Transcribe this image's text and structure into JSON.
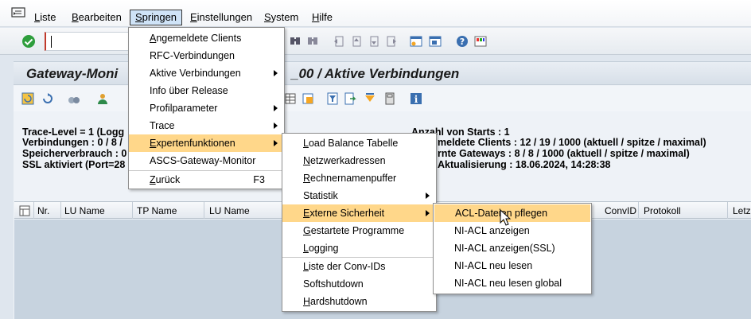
{
  "menubar": {
    "items": [
      {
        "label": "Liste",
        "u": "L",
        "rest": "iste"
      },
      {
        "label": "Bearbeiten",
        "u": "B",
        "rest": "earbeiten"
      },
      {
        "label": "Springen",
        "u": "S",
        "rest": "pringen"
      },
      {
        "label": "Einstellungen",
        "u": "E",
        "rest": "instellungen"
      },
      {
        "label": "System",
        "u": "S",
        "rest": "ystem"
      },
      {
        "label": "Hilfe",
        "u": "H",
        "rest": "ilfe"
      }
    ]
  },
  "title": {
    "left": "Gateway-Moni",
    "right": "_00 / Aktive Verbindungen"
  },
  "info": {
    "line1_left": "Trace-Level = 1 (Logg",
    "line2_left": "Verbindungen : 0 / 8 /",
    "line3_left": "Speicherverbrauch : 0",
    "line4_left": "SSL aktiviert (Port=28",
    "line1_right": "Anzahl von Starts : 1",
    "line2_right": "meldete Clients : 12 / 19 / 1000 (aktuell / spitze / maximal)",
    "line3_right": "rnte Gateways : 8 / 8 / 1000 (aktuell / spitze / maximal)",
    "line4_right": "Aktualisierung : 18.06.2024, 14:28:38"
  },
  "grid": {
    "columns": [
      "Nr.",
      "LU Name",
      "TP Name",
      "LU Name",
      "ConvID",
      "Protokoll",
      "Letz"
    ]
  },
  "springen_menu": {
    "items": [
      {
        "label": "Angemeldete Clients",
        "u": "A",
        "rest": "ngemeldete Clients",
        "submenu": false
      },
      {
        "label": "RFC-Verbindungen",
        "u": "",
        "rest": "RFC-Verbindungen",
        "submenu": false
      },
      {
        "label": "Aktive Verbindungen",
        "u": "",
        "rest": "Aktive Verbindungen",
        "submenu": true
      },
      {
        "label": "Info über Release",
        "u": "",
        "rest": "Info über Release",
        "submenu": false
      },
      {
        "label": "Profilparameter",
        "u": "",
        "rest": "Profilparameter",
        "submenu": true
      },
      {
        "label": "Trace",
        "u": "",
        "rest": "Trace",
        "submenu": true
      },
      {
        "label": "Expertenfunktionen",
        "u": "E",
        "rest": "xpertenfunktionen",
        "submenu": true
      },
      {
        "label": "ASCS-Gateway-Monitor",
        "u": "",
        "rest": "ASCS-Gateway-Monitor",
        "submenu": false
      },
      {
        "label": "Zurück",
        "u": "Z",
        "rest": "urück",
        "submenu": false,
        "shortcut": "F3"
      }
    ]
  },
  "experten_menu": {
    "items": [
      {
        "label": "Load Balance Tabelle",
        "u": "L",
        "rest": "oad Balance Tabelle",
        "submenu": false
      },
      {
        "label": "Netzwerkadressen",
        "u": "N",
        "rest": "etzwerkadressen",
        "submenu": false
      },
      {
        "label": "Rechnernamenpuffer",
        "u": "R",
        "rest": "echnernamenpuffer",
        "submenu": false
      },
      {
        "label": "Statistik",
        "u": "",
        "rest": "Statistik",
        "submenu": true
      },
      {
        "label": "Externe Sicherheit",
        "u": "E",
        "rest": "xterne Sicherheit",
        "submenu": true
      },
      {
        "label": "Gestartete Programme",
        "u": "G",
        "rest": "estartete Programme",
        "submenu": false
      },
      {
        "label": "Logging",
        "u": "L",
        "rest": "ogging",
        "submenu": false
      },
      {
        "label": "Liste der Conv-IDs",
        "u": "L",
        "rest": "iste der Conv-IDs",
        "submenu": false
      },
      {
        "label": "Softshutdown",
        "u": "",
        "rest": "Softshutdown",
        "submenu": false
      },
      {
        "label": "Hardshutdown",
        "u": "H",
        "rest": "ardshutdown",
        "submenu": false
      }
    ]
  },
  "sicherheit_menu": {
    "items": [
      {
        "label": "ACL-Dateien pflegen",
        "submenu": false
      },
      {
        "label": "NI-ACL anzeigen",
        "submenu": false
      },
      {
        "label": "NI-ACL anzeigen(SSL)",
        "submenu": false
      },
      {
        "label": "NI-ACL neu lesen",
        "submenu": false
      },
      {
        "label": "NI-ACL neu lesen global",
        "submenu": false
      }
    ]
  },
  "colors": {
    "highlight": "#ffd78a",
    "grid_body": "#c7d3df",
    "accent_green": "#2e9e3c"
  }
}
